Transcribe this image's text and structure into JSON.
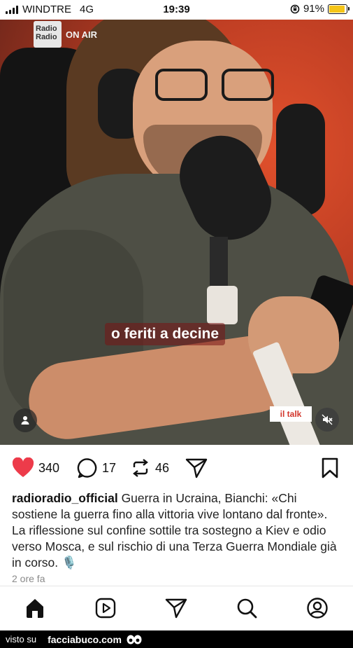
{
  "status_bar": {
    "carrier": "WINDTRE",
    "network": "4G",
    "time": "19:39",
    "battery": "91%",
    "battery_level": 0.91,
    "battery_color": "#f5c518"
  },
  "video": {
    "brand": "Radio\nRadio",
    "on_air": "ON AIR",
    "subtitle": "o feriti a decine",
    "badge": "il talk",
    "user_icon": "user-icon",
    "mute_icon": "speaker-muted-icon"
  },
  "actions": {
    "likes": "340",
    "comments": "17",
    "reposts": "46",
    "like_color": "#ed3b4a"
  },
  "post": {
    "username": "radioradio_official",
    "caption": " Guerra in Ucraina, Bianchi: «Chi sostiene la guerra fino alla vittoria vive lontano dal fronte». La riflessione sul confine sottile tra sostegno a Kiev e odio verso Mosca, e sul rischio di una Terza Guerra Mondiale già in corso. ",
    "emoji": "🎙️",
    "time_ago": "2 ore fa"
  },
  "nav": [
    "home-icon",
    "reels-icon",
    "send-icon",
    "search-icon",
    "profile-icon"
  ],
  "watermark": {
    "prefix": "visto su",
    "site": "facciabuco.com"
  }
}
